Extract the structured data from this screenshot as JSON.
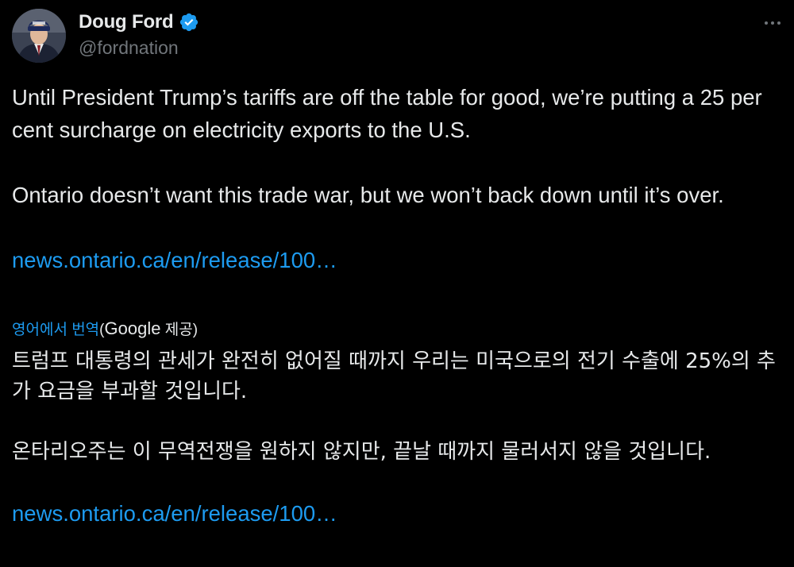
{
  "tweet": {
    "author": {
      "display_name": "Doug Ford",
      "handle": "@fordnation",
      "verified_icon": "verified-badge-icon",
      "verified_color": "#1d9bf0"
    },
    "more_icon": "more-dots-icon",
    "text": {
      "paragraph_1": "Until President Trump’s tariffs are off the table for good, we’re putting a 25 per cent surcharge on electricity exports to the U.S.",
      "paragraph_2": "Ontario doesn’t want this trade war, but we won’t back down until it’s over."
    },
    "link": "news.ontario.ca/en/release/100…",
    "translation": {
      "label": "영어에서 번역",
      "provider_prefix": "(",
      "provider": "Google",
      "provider_suffix": " 제공)",
      "paragraph_1": "트럼프 대통령의 관세가 완전히 없어질 때까지 우리는 미국으로의 전기 수출에 25%의 추가 요금을 부과할 것입니다.",
      "paragraph_2": "온타리오주는 이 무역전쟁을 원하지 않지만, 끝날 때까지 물러서지 않을 것입니다.",
      "link": "news.ontario.ca/en/release/100…"
    },
    "colors": {
      "background": "#000000",
      "text": "#e7e9ea",
      "secondary_text": "#71767b",
      "link": "#1d9bf0"
    }
  }
}
